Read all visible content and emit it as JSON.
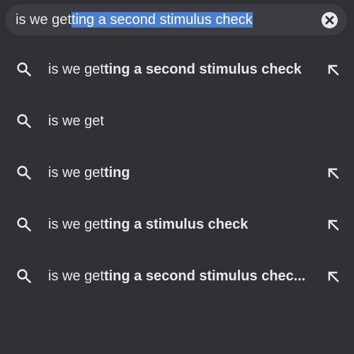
{
  "search": {
    "query_prefix": "is we get",
    "query_selected": "ting a second stimulus check",
    "clear_icon": "close-circle-icon"
  },
  "suggestions": [
    {
      "prefix": "is we get",
      "bold": "ting a second stimulus check",
      "has_fill_arrow": true
    },
    {
      "prefix": "is we get",
      "bold": "",
      "has_fill_arrow": false
    },
    {
      "prefix": "is we get",
      "bold": "ting",
      "has_fill_arrow": true
    },
    {
      "prefix": "is we get",
      "bold": "ting a stimulus check",
      "has_fill_arrow": true
    },
    {
      "prefix": "is we get",
      "bold": "ting a second stimulus chec...",
      "has_fill_arrow": true
    }
  ],
  "colors": {
    "background": "#303134",
    "search_bar": "#3c3d41",
    "text": "#e8eaed",
    "selection": "#4a7fd4"
  }
}
